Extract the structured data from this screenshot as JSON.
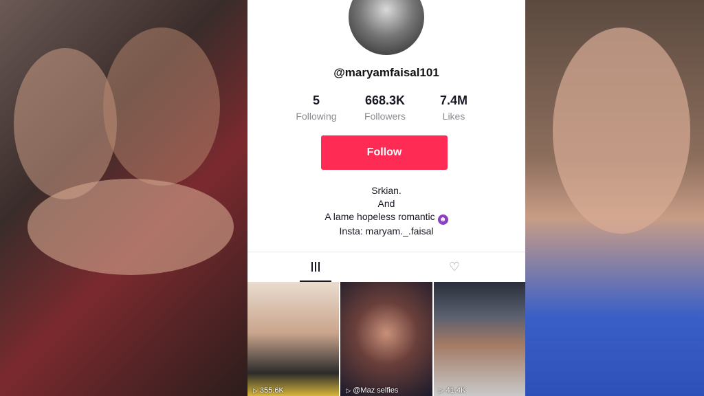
{
  "profile": {
    "username": "@maryamfaisal101",
    "stats": [
      {
        "value": "5",
        "label": "Following"
      },
      {
        "value": "668.3K",
        "label": "Followers"
      },
      {
        "value": "7.4M",
        "label": "Likes"
      }
    ],
    "follow_label": "Follow",
    "bio": [
      "Srkian.",
      "And",
      "A lame hopeless romantic",
      "Insta: maryam._.faisal"
    ],
    "accent_color": "#fe2c55"
  },
  "tabs": {
    "videos_icon": "grid-icon",
    "liked_icon": "heart-lock-icon"
  },
  "thumbnails": [
    {
      "views": "355.6K"
    },
    {
      "views": "@Maz selfies"
    },
    {
      "views": "41.4K"
    }
  ]
}
